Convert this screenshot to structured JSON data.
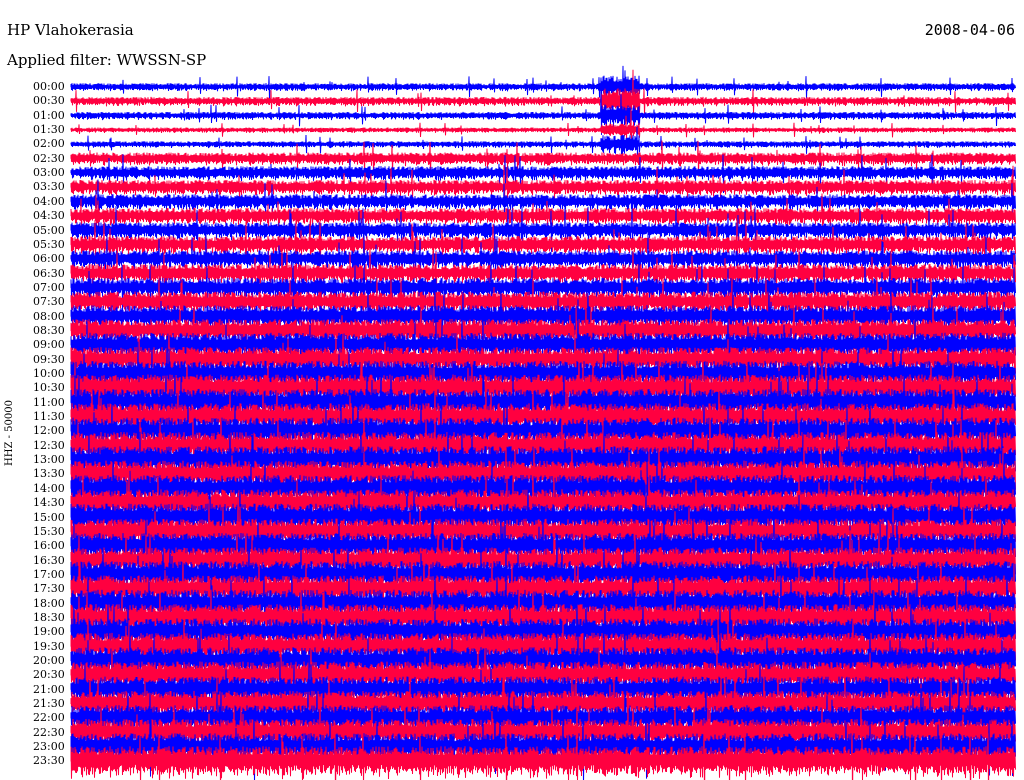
{
  "chart_data": {
    "type": "line",
    "title": "HP Vlahokerasia",
    "subtitle": "Applied filter: WWSSN-SP",
    "date": "2008-04-06",
    "ylabel": "HHZ - 50000",
    "row_labels": [
      "00:00",
      "00:30",
      "01:00",
      "01:30",
      "02:00",
      "02:30",
      "03:00",
      "03:30",
      "04:00",
      "04:30",
      "05:00",
      "05:30",
      "06:00",
      "06:30",
      "07:00",
      "07:30",
      "08:00",
      "08:30",
      "09:00",
      "09:30",
      "10:00",
      "10:30",
      "11:00",
      "11:30",
      "12:00",
      "12:30",
      "13:00",
      "13:30",
      "14:00",
      "14:30",
      "15:00",
      "15:30",
      "16:00",
      "16:30",
      "17:00",
      "17:30",
      "18:00",
      "18:30",
      "19:00",
      "19:30",
      "20:00",
      "20:30",
      "21:00",
      "21:30",
      "22:00",
      "22:30",
      "23:00",
      "23:30"
    ],
    "series_colors": [
      "#0000ff",
      "#ff0040"
    ],
    "row_amplitude_level": [
      0.3,
      0.35,
      0.3,
      0.2,
      0.25,
      0.5,
      0.55,
      0.6,
      0.6,
      0.65,
      0.65,
      0.7,
      0.7,
      0.75,
      0.8,
      0.85,
      0.9,
      0.95,
      1,
      1,
      1.05,
      1.1,
      1.1,
      1.1,
      1.1,
      1.1,
      1.1,
      1.1,
      1.1,
      1.1,
      1.1,
      1.05,
      1.05,
      1.05,
      1.1,
      1.1,
      1.1,
      1.1,
      1.1,
      1.1,
      1.1,
      1.1,
      1.05,
      1.05,
      1.05,
      1.1,
      1.1,
      1.2
    ],
    "grid": false
  }
}
